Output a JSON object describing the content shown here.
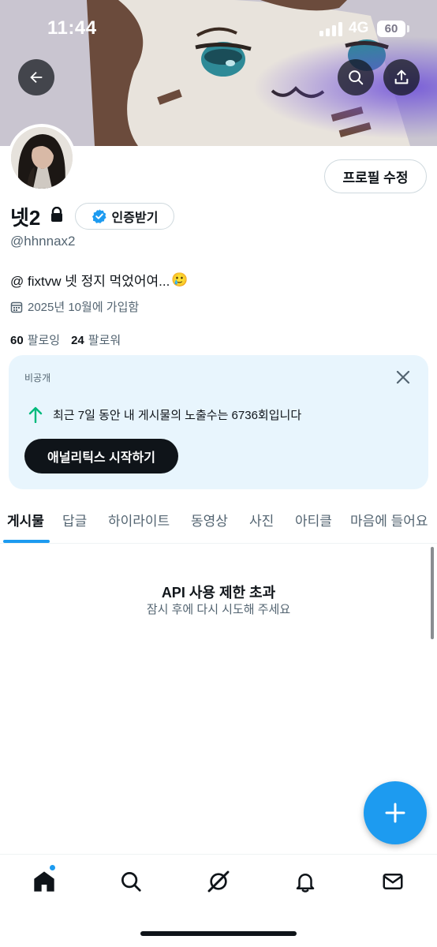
{
  "status_bar": {
    "time": "11:44",
    "network": "4G",
    "battery": "60"
  },
  "profile": {
    "name": "넷2",
    "handle": "@hhnnax2",
    "bio": "@ fixtvw 넷 정지 먹었어여...",
    "bio_emoji": "🥲",
    "joined": "2025년 10월에 가입함",
    "following_count": "60",
    "following_label": "팔로잉",
    "followers_count": "24",
    "followers_label": "팔로워",
    "edit_button": "프로필 수정",
    "verify_button": "인증받기"
  },
  "analytics_card": {
    "label": "비공개",
    "stat_text": "최근 7일 동안 내 게시물의 노출수는 6736회입니다",
    "cta": "애널리틱스 시작하기"
  },
  "tabs": [
    {
      "label": "게시물",
      "active": true
    },
    {
      "label": "답글",
      "active": false
    },
    {
      "label": "하이라이트",
      "active": false
    },
    {
      "label": "동영상",
      "active": false
    },
    {
      "label": "사진",
      "active": false
    },
    {
      "label": "아티클",
      "active": false
    },
    {
      "label": "마음에 들어요",
      "active": false
    }
  ],
  "empty_state": {
    "title": "API 사용 제한 초과",
    "subtitle": "잠시 후에 다시 시도해 주세요"
  },
  "colors": {
    "accent": "#1d9bf0",
    "text": "#0f1419",
    "secondary": "#536471",
    "card_bg": "#e8f5fd",
    "positive": "#00ba7c"
  },
  "icons": {
    "back": "arrow-left-icon",
    "search": "search-icon",
    "share": "share-icon",
    "lock": "lock-icon",
    "verified": "verified-badge-icon",
    "calendar": "calendar-icon",
    "close": "close-icon",
    "trend_up": "arrow-up-icon",
    "compose": "plus-icon",
    "nav": [
      "home-icon",
      "search-icon",
      "grok-icon",
      "bell-icon",
      "mail-icon"
    ]
  }
}
